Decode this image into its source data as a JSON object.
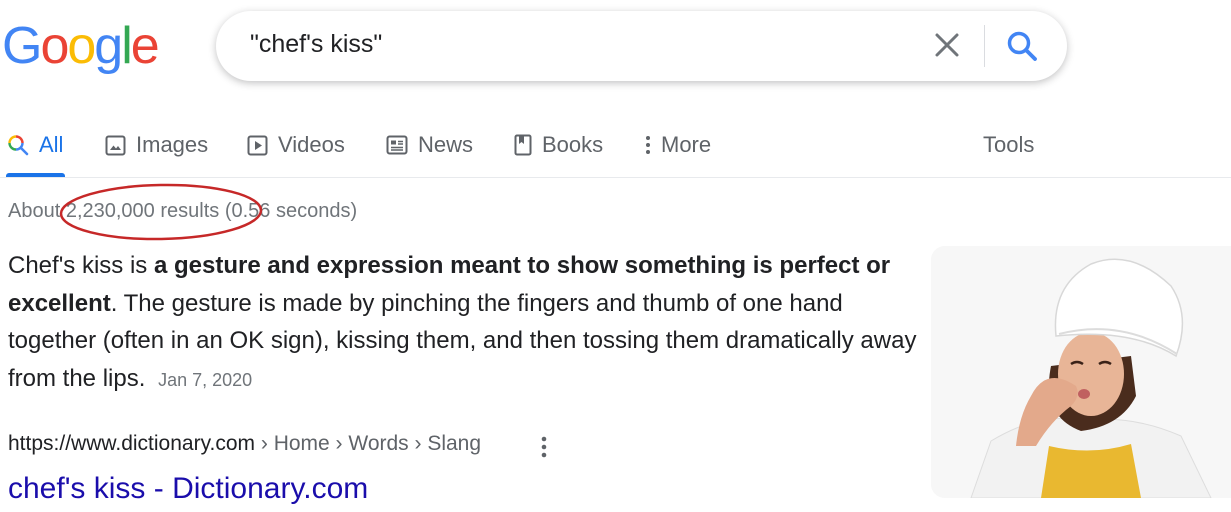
{
  "logo": {
    "letters": [
      "G",
      "o",
      "o",
      "g",
      "l",
      "e"
    ],
    "colors": [
      "#4285F4",
      "#EA4335",
      "#FBBC05",
      "#4285F4",
      "#34A853",
      "#EA4335"
    ]
  },
  "search": {
    "query": "\"chef's kiss\""
  },
  "tabs": {
    "all": "All",
    "images": "Images",
    "videos": "Videos",
    "news": "News",
    "books": "Books",
    "more": "More",
    "tools": "Tools",
    "active": "All"
  },
  "stats": {
    "prefix": "About ",
    "count": "2,230,000 results",
    "suffix": " (0.56 seconds)"
  },
  "snippet": {
    "lead": "Chef's kiss is ",
    "bold": "a gesture and expression meant to show something is perfect or excellent",
    "rest": ". The gesture is made by pinching the fingers and thumb of one hand together (often in an OK sign), kissing them, and then tossing them dramatically away from the lips.",
    "date": "Jan 7, 2020"
  },
  "result": {
    "url_host": "https://www.dictionary.com",
    "breadcrumb": " › Home › Words › Slang",
    "title": "chef's kiss - Dictionary.com"
  },
  "colors": {
    "accent": "#1a73e8",
    "link": "#1a0dab",
    "annotation": "#c62828"
  }
}
